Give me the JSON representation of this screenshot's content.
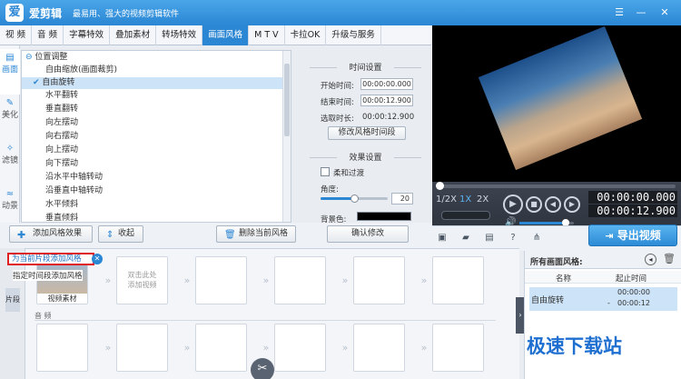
{
  "app": {
    "logo_glyph": "爱",
    "name": "爱剪辑",
    "slogan": "最易用、强大的视频剪辑软件",
    "controls": {
      "menu": "☰",
      "minimize": "—",
      "close": "✕"
    }
  },
  "tabs": [
    {
      "label": "视  频"
    },
    {
      "label": "音  频"
    },
    {
      "label": "字幕特效"
    },
    {
      "label": "叠加素材"
    },
    {
      "label": "转场特效"
    },
    {
      "label": "画面风格",
      "active": true
    },
    {
      "label": "M T V"
    },
    {
      "label": "卡拉OK"
    },
    {
      "label": "升级与服务"
    }
  ],
  "side_tabs": [
    {
      "label": "画面",
      "icon": "▤",
      "active": true
    },
    {
      "label": "美化",
      "icon": "✎"
    },
    {
      "label": "滤镜",
      "icon": "✧"
    },
    {
      "label": "动景",
      "icon": "≈"
    }
  ],
  "tree": {
    "group": "位置调整",
    "items": [
      "自由缩放(画面裁剪)",
      "自由旋转",
      "水平翻转",
      "垂直翻转",
      "向左摆动",
      "向右摆动",
      "向上摆动",
      "向下摆动",
      "沿水平中轴转动",
      "沿垂直中轴转动",
      "水平倾斜",
      "垂直倾斜"
    ],
    "selected_index": 1
  },
  "time_settings": {
    "title": "时间设置",
    "start_label": "开始时间:",
    "start_value": "00:00:00.000",
    "end_label": "结束时间:",
    "end_value": "00:00:12.900",
    "duration_label": "选取时长:",
    "duration_value": "00:00:12.900",
    "modify_button": "修改风格时间段"
  },
  "effect_settings": {
    "title": "效果设置",
    "smooth_label": "柔和过渡",
    "smooth_checked": false,
    "angle_label": "角度:",
    "angle_value": "20",
    "angle_fraction": 0.5,
    "bg_label": "背景色:",
    "bg_color": "#000000"
  },
  "actions": {
    "add_style": "添加风格效果",
    "collapse": "收起",
    "delete_style": "删除当前风格",
    "confirm": "确认修改"
  },
  "popup": {
    "item1": "为当前片段添加风格",
    "item2": "指定时间段添加风格"
  },
  "player": {
    "speeds": [
      "1/2X",
      "1X",
      "2X"
    ],
    "time_current": "00:00:00.000",
    "time_total": "00:00:12.900",
    "progress": 0,
    "volume": 0.85
  },
  "export_button": "导出视频",
  "timeline": {
    "segment_tab": "片段",
    "video_clip_label": "视频素材",
    "placeholder": "双击此处\n添加视频",
    "audio_label": "音 频"
  },
  "styles_panel": {
    "title": "所有画面风格:",
    "col_name": "名称",
    "col_time": "起止时间",
    "rows": [
      {
        "name": "自由旋转",
        "start": "00:00:00",
        "end": "00:00:12"
      }
    ]
  },
  "watermark": "极速下载站",
  "colors": {
    "accent": "#2b86d4",
    "highlight": "#cde3f7",
    "popup_border": "#e02020",
    "preview_bg": "#000000"
  }
}
